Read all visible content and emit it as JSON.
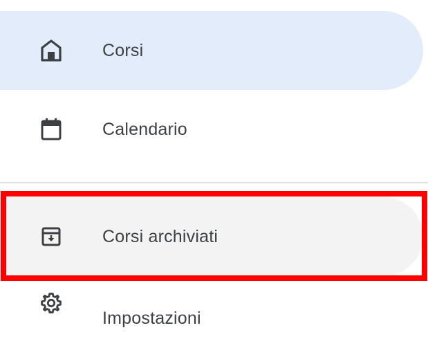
{
  "nav": {
    "items": [
      {
        "label": "Corsi",
        "icon": "home-icon",
        "state": "selected"
      },
      {
        "label": "Calendario",
        "icon": "calendar-icon",
        "state": "default"
      },
      {
        "label": "Corsi archiviati",
        "icon": "archive-icon",
        "state": "hover-highlighted"
      },
      {
        "label": "Impostazioni",
        "icon": "settings-gear-icon",
        "state": "default"
      }
    ]
  },
  "colors": {
    "selected_background": "#e3ecfb",
    "hover_background": "#f3f3f3",
    "highlight_border": "#ff0000",
    "icon_color": "#3c4043",
    "divider": "#e0e0e0"
  }
}
